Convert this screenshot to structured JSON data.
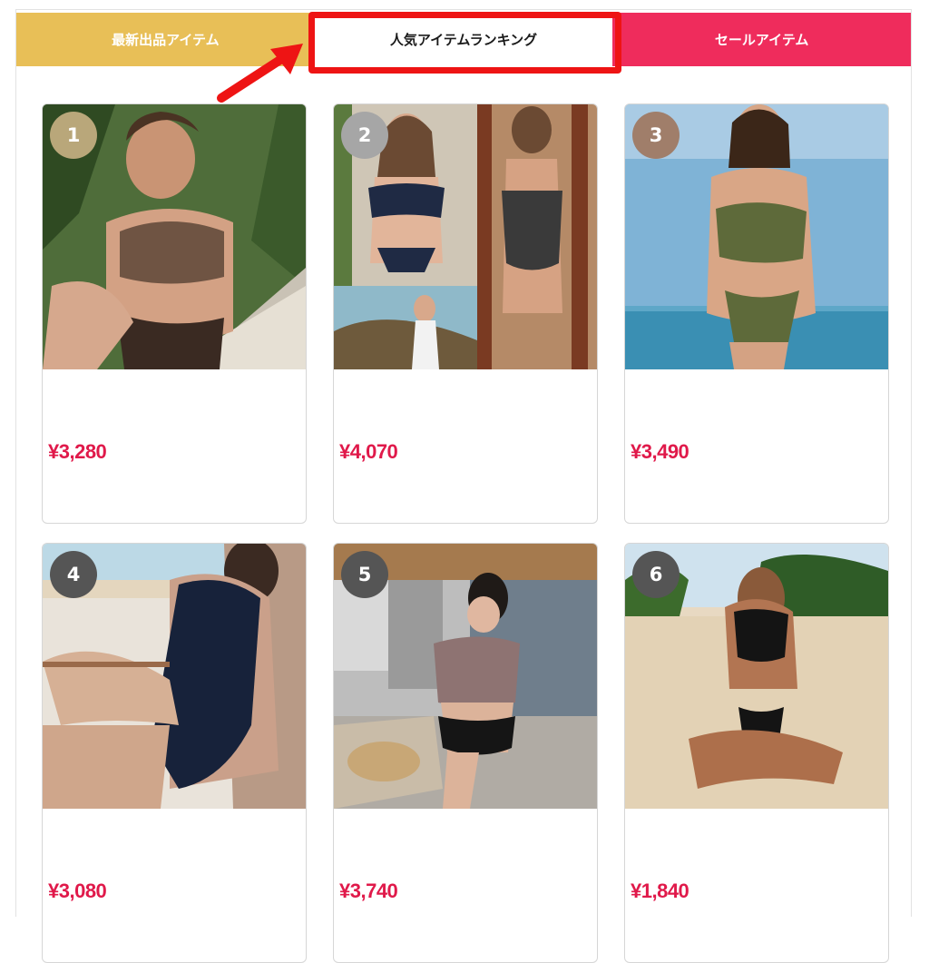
{
  "tabs": {
    "new_items": "最新出品アイテム",
    "ranking": "人気アイテムランキング",
    "sale": "セールアイテム"
  },
  "products": [
    {
      "rank": "1",
      "price": "¥3,280",
      "badge_color": "#b9a77a"
    },
    {
      "rank": "2",
      "price": "¥4,070",
      "badge_color": "#a6a6a6"
    },
    {
      "rank": "3",
      "price": "¥3,490",
      "badge_color": "#a07e6a"
    },
    {
      "rank": "4",
      "price": "¥3,080",
      "badge_color": "#555555"
    },
    {
      "rank": "5",
      "price": "¥3,740",
      "badge_color": "#555555"
    },
    {
      "rank": "6",
      "price": "¥1,840",
      "badge_color": "#555555"
    }
  ],
  "colors": {
    "new_tab": "#e8bf57",
    "sale_tab": "#ef2c5c",
    "price": "#e0194a",
    "highlight": "#ee1414"
  },
  "icons": {
    "arrow": "red-arrow-icon"
  }
}
